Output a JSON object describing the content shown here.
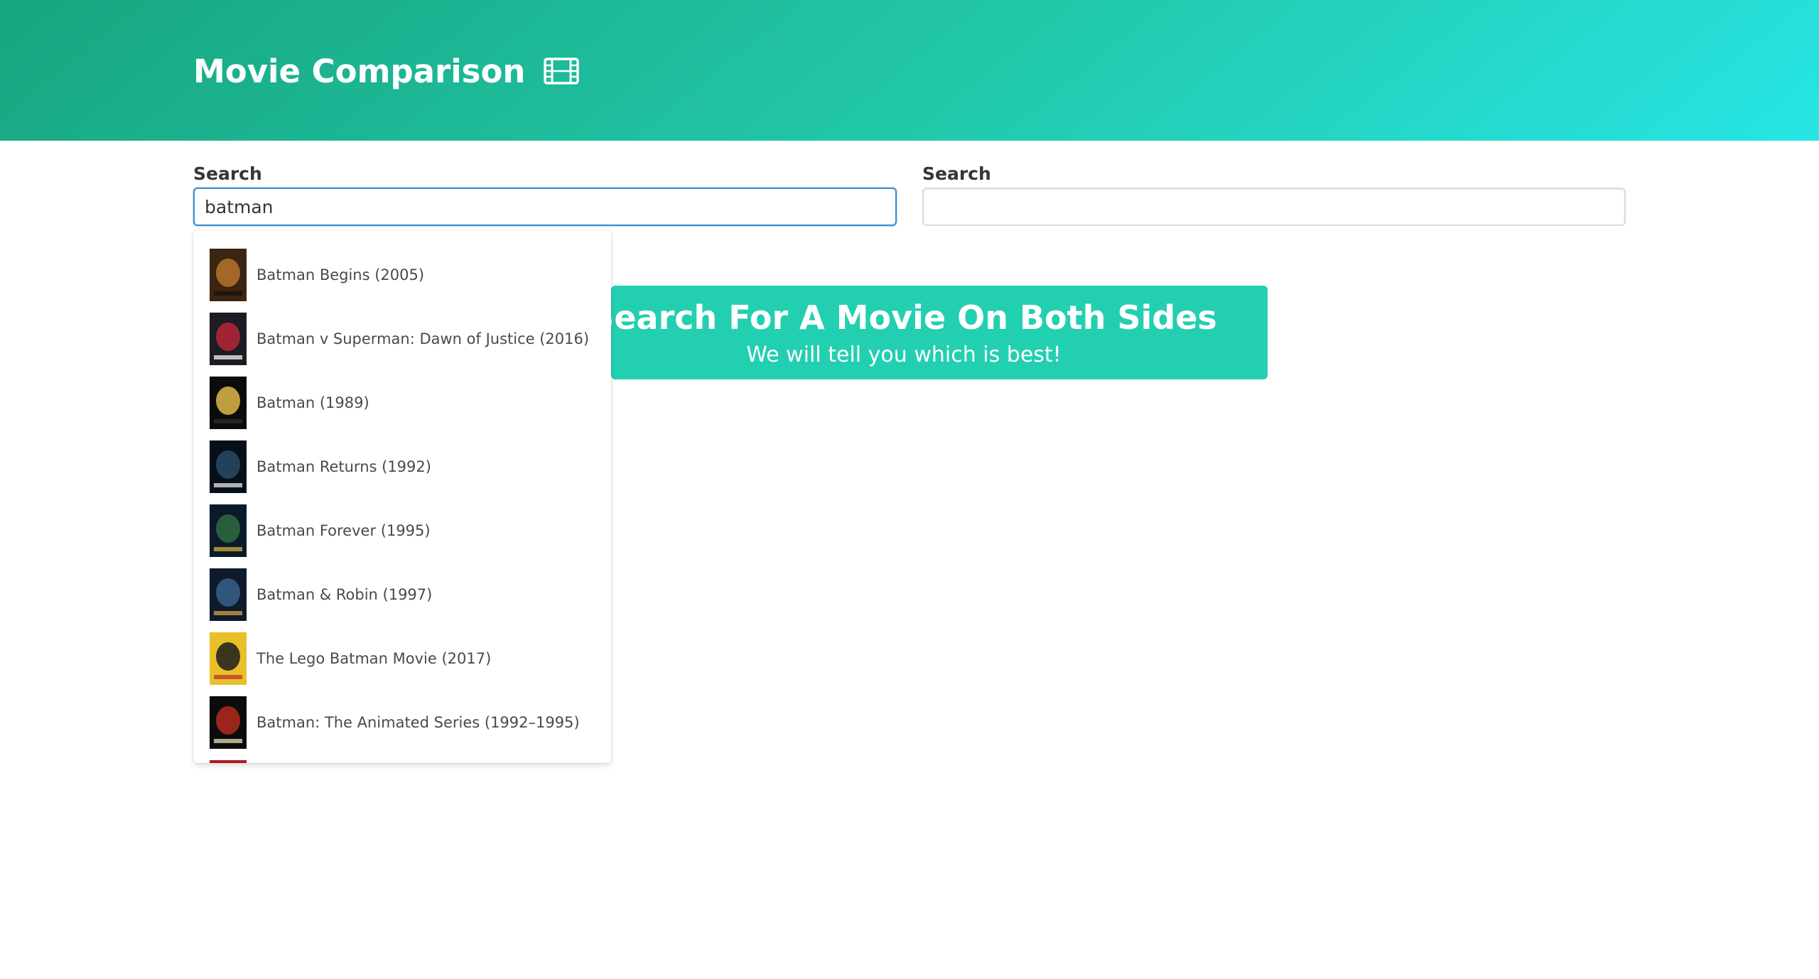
{
  "header": {
    "title": "Movie Comparison",
    "icon": "film-icon"
  },
  "left_search": {
    "label": "Search",
    "value": "batman",
    "placeholder": ""
  },
  "right_search": {
    "label": "Search",
    "value": "",
    "placeholder": ""
  },
  "notice": {
    "title": "Search For A Movie On Both Sides",
    "subtitle": "We will tell you which is best!"
  },
  "dropdown": {
    "items": [
      {
        "label": "Batman Begins (2005)",
        "poster_colors": [
          "#3b2410",
          "#b5742c",
          "#1a0f06"
        ]
      },
      {
        "label": "Batman v Superman: Dawn of Justice (2016)",
        "poster_colors": [
          "#1c1c22",
          "#b8263a",
          "#e7e7ea"
        ]
      },
      {
        "label": "Batman (1989)",
        "poster_colors": [
          "#0b0b0b",
          "#e0b84a",
          "#2a2a2a"
        ]
      },
      {
        "label": "Batman Returns (1992)",
        "poster_colors": [
          "#06101a",
          "#2c4a66",
          "#d9d9e0"
        ]
      },
      {
        "label": "Batman Forever (1995)",
        "poster_colors": [
          "#0a1a2a",
          "#2e6b3f",
          "#c8a43a"
        ]
      },
      {
        "label": "Batman & Robin (1997)",
        "poster_colors": [
          "#0d1b2b",
          "#3a5f8a",
          "#c99a3d"
        ]
      },
      {
        "label": "The Lego Batman Movie (2017)",
        "poster_colors": [
          "#e8c12a",
          "#1c1c1c",
          "#c23b2a"
        ]
      },
      {
        "label": "Batman: The Animated Series (1992–1995)",
        "poster_colors": [
          "#0c0c0c",
          "#b52a1f",
          "#d9d0b0"
        ]
      },
      {
        "label": "",
        "poster_colors": [
          "#b0161f",
          "#5a0b10",
          "#e04a3a"
        ]
      }
    ]
  },
  "colors": {
    "hero_start": "#18a57f",
    "hero_end": "#27e5e5",
    "notice_bg": "#23cfb1",
    "focus_border": "#3e8ed0"
  }
}
